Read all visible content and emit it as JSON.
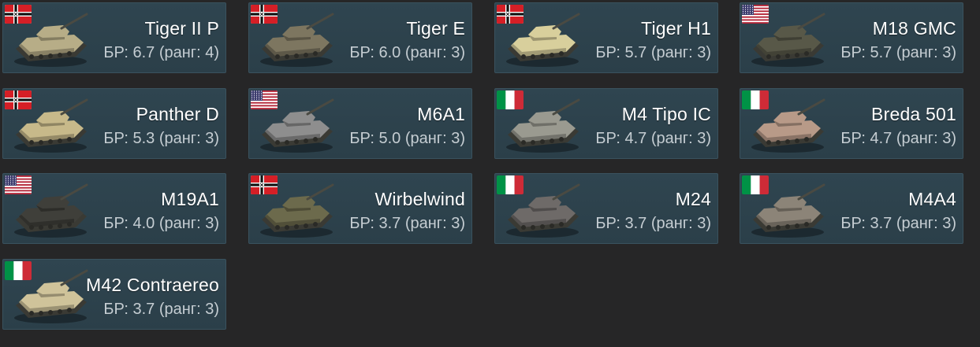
{
  "vehicles": [
    {
      "name": "Tiger II P",
      "br": "БР: 6.7 (ранг: 4)",
      "nation": "germany",
      "flag_icon": "germany-flag-icon",
      "camo": "#b7ad87"
    },
    {
      "name": "Tiger E",
      "br": "БР: 6.0 (ранг: 3)",
      "nation": "germany",
      "flag_icon": "germany-flag-icon",
      "camo": "#7d7660"
    },
    {
      "name": "Tiger H1",
      "br": "БР: 5.7 (ранг: 3)",
      "nation": "germany",
      "flag_icon": "germany-flag-icon",
      "camo": "#d8cf9c"
    },
    {
      "name": "M18 GMC",
      "br": "БР: 5.7 (ранг: 3)",
      "nation": "usa",
      "flag_icon": "usa-flag-icon",
      "camo": "#585848"
    },
    {
      "name": "Panther D",
      "br": "БР: 5.3 (ранг: 3)",
      "nation": "germany",
      "flag_icon": "germany-flag-icon",
      "camo": "#c7b98a"
    },
    {
      "name": "M6A1",
      "br": "БР: 5.0 (ранг: 3)",
      "nation": "usa",
      "flag_icon": "usa-flag-icon",
      "camo": "#8e8e8e"
    },
    {
      "name": "M4 Tipo IC",
      "br": "БР: 4.7 (ранг: 3)",
      "nation": "italy",
      "flag_icon": "italy-flag-icon",
      "camo": "#9a9a90"
    },
    {
      "name": "Breda 501",
      "br": "БР: 4.7 (ранг: 3)",
      "nation": "italy",
      "flag_icon": "italy-flag-icon",
      "camo": "#b89a88"
    },
    {
      "name": "M19A1",
      "br": "БР: 4.0 (ранг: 3)",
      "nation": "usa",
      "flag_icon": "usa-flag-icon",
      "camo": "#3f3f3a"
    },
    {
      "name": "Wirbelwind",
      "br": "БР: 3.7 (ранг: 3)",
      "nation": "germany",
      "flag_icon": "germany-flag-icon",
      "camo": "#6c6a4c"
    },
    {
      "name": "M24",
      "br": "БР: 3.7 (ранг: 3)",
      "nation": "italy",
      "flag_icon": "italy-flag-icon",
      "camo": "#6e6a68"
    },
    {
      "name": "M4A4",
      "br": "БР: 3.7 (ранг: 3)",
      "nation": "italy",
      "flag_icon": "italy-flag-icon",
      "camo": "#8c8478"
    },
    {
      "name": "M42 Contraereo",
      "br": "БР: 3.7 (ранг: 3)",
      "nation": "italy",
      "flag_icon": "italy-flag-icon",
      "camo": "#cfc39a"
    }
  ]
}
